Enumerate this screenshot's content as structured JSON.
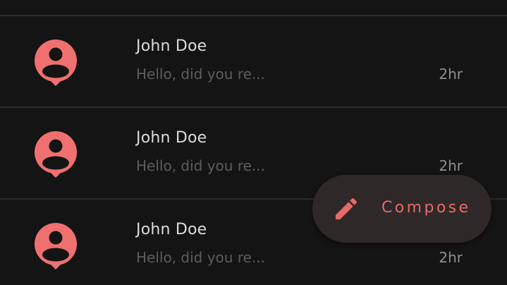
{
  "theme": {
    "background": "#141414",
    "divider": "#2c2c2c",
    "accent": "#f07070",
    "name_color": "#dcdcdc",
    "preview_color": "#5c5c5c",
    "time_color": "#8e8e8e",
    "fab_background": "#2f2828",
    "fab_text": "#e56a6a"
  },
  "messages": [
    {
      "sender": "John Doe",
      "preview": "Hello, did you re...",
      "time": "2hr",
      "avatar_icon": "person-pin-icon"
    },
    {
      "sender": "John Doe",
      "preview": "Hello, did you re...",
      "time": "2hr",
      "avatar_icon": "person-pin-icon"
    },
    {
      "sender": "John Doe",
      "preview": "Hello, did you re...",
      "time": "2hr",
      "avatar_icon": "person-pin-icon"
    }
  ],
  "fab": {
    "label": "Compose",
    "icon": "pencil-icon"
  }
}
